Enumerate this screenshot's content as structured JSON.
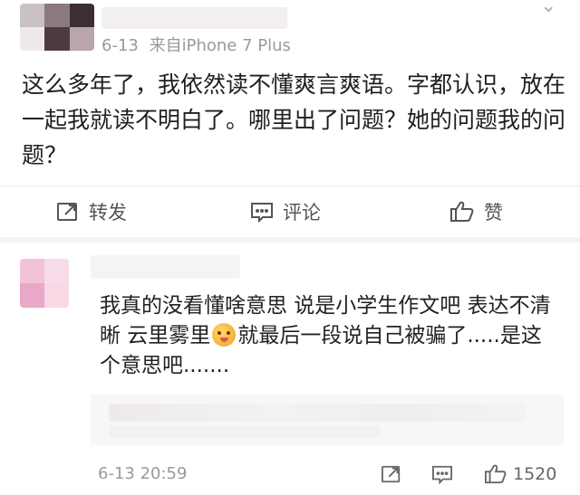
{
  "post": {
    "time": "6-13",
    "source": "来自iPhone 7 Plus",
    "text": "这么多年了，我依然读不懂爽言爽语。字都认识，放在一起我就读不明白了。哪里出了问题？她的问题我的问题？",
    "actions": {
      "repost": "转发",
      "comment": "评论",
      "like": "赞"
    }
  },
  "comment": {
    "text_before_emoji": "我真的没看懂啥意思 说是小学生作文吧 表达不清晰 云里雾里",
    "emoji_name": "emoji-smirk",
    "text_after_emoji": "就最后一段说自己被骗了.....是这个意思吧.......",
    "time": "6-13 20:59",
    "like_count": "1520"
  },
  "colors": {
    "text": "#1f1f1f",
    "meta": "#9a9a9a",
    "icon": "#555555"
  }
}
